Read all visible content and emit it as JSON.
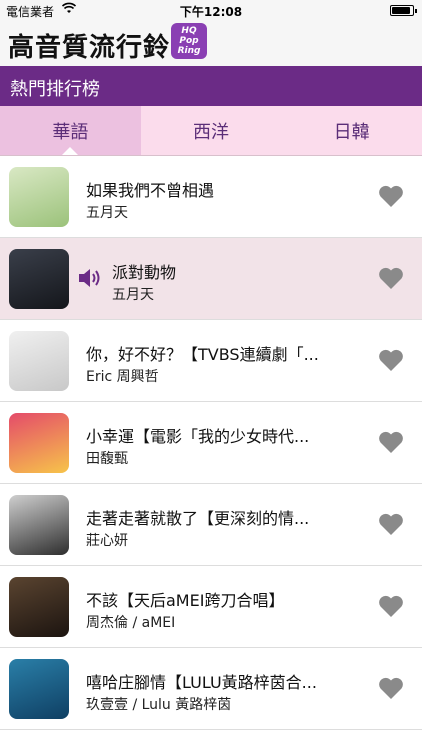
{
  "status": {
    "carrier": "電信業者",
    "time": "下午12:08",
    "battery_level": 0.9
  },
  "app": {
    "title": "高音質流行鈴",
    "logo_lines": [
      "HQ",
      "Pop",
      "Ring"
    ]
  },
  "section": {
    "title": "熱門排行榜"
  },
  "tabs": [
    {
      "label": "華語",
      "active": true
    },
    {
      "label": "西洋",
      "active": false
    },
    {
      "label": "日韓",
      "active": false
    }
  ],
  "songs": [
    {
      "title": "如果我們不曾相遇",
      "artist": "五月天",
      "playing": false,
      "thumb_colors": [
        "#d9e8c4",
        "#9bc27a"
      ]
    },
    {
      "title": "派對動物",
      "artist": "五月天",
      "playing": true,
      "thumb_colors": [
        "#3a3f4a",
        "#14161b"
      ]
    },
    {
      "title": "你，好不好？【TVBS連續劇「...",
      "artist": "Eric 周興哲",
      "playing": false,
      "thumb_colors": [
        "#f0f0f0",
        "#c8c8c8"
      ]
    },
    {
      "title": "小幸運【電影「我的少女時代...",
      "artist": "田馥甄",
      "playing": false,
      "thumb_colors": [
        "#e44b6a",
        "#f7c44a"
      ]
    },
    {
      "title": "走著走著就散了【更深刻的情...",
      "artist": "莊心妍",
      "playing": false,
      "thumb_colors": [
        "#cfcfcf",
        "#2e2e2e"
      ]
    },
    {
      "title": "不該【天后aMEI跨刀合唱】",
      "artist": "周杰倫 / aMEI",
      "playing": false,
      "thumb_colors": [
        "#5a4430",
        "#1c1410"
      ]
    },
    {
      "title": "嘻哈庄腳情【LULU黃路梓茵合...",
      "artist": "玖壹壹 / Lulu 黃路梓茵",
      "playing": false,
      "thumb_colors": [
        "#2a7fa8",
        "#0f3f63"
      ]
    }
  ],
  "colors": {
    "accent": "#6b2b86",
    "tab_bg": "#fbdcec",
    "tab_active": "#ecc1e0",
    "playing_row": "#f2e3e8",
    "heart": "#8a8a8a"
  },
  "icons": {
    "wifi": "wifi-icon",
    "speaker": "speaker-icon",
    "heart": "heart-icon"
  }
}
